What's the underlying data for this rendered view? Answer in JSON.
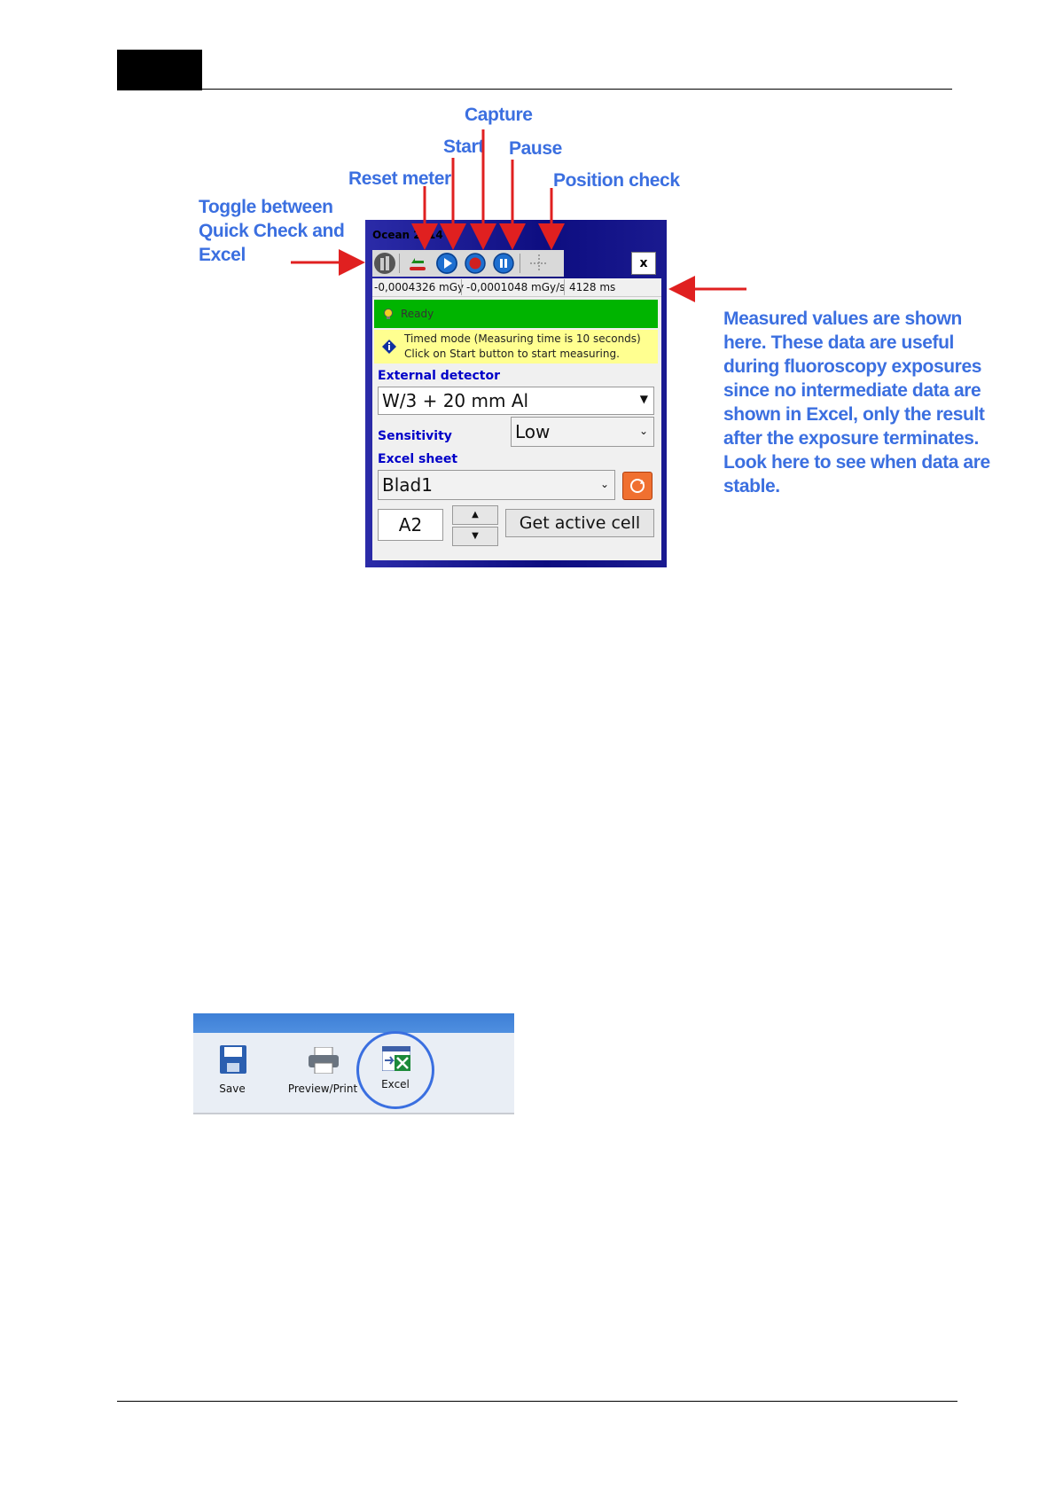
{
  "callouts": {
    "capture": "Capture",
    "start": "Start",
    "pause": "Pause",
    "reset": "Reset meter",
    "position": "Position check",
    "toggle": [
      "Toggle between",
      "Quick Check and",
      "Excel"
    ],
    "measured": [
      "Measured values are shown",
      "here. These data are useful",
      "during fluoroscopy exposures",
      "since no intermediate data are",
      "shown in Excel, only the result",
      "after the exposure terminates.",
      "Look here to see when data are",
      "stable."
    ]
  },
  "window": {
    "title": "Ocean 2014",
    "close": "x",
    "dose": "-0,0004326 mGy",
    "rate": "-0,0001048 mGy/s",
    "time": "4128 ms",
    "status": "Ready",
    "timed_line1": "Timed mode (Measuring time is 10 seconds)",
    "timed_line2": "Click on Start button to start measuring.",
    "ext_label": "External detector",
    "ext_value": "W/3 + 20 mm Al",
    "sens_label": "Sensitivity",
    "sens_value": "Low",
    "sheet_label": "Excel sheet",
    "sheet_value": "Blad1",
    "cell_value": "A2",
    "get_cell": "Get active cell"
  },
  "ribbon": {
    "save": "Save",
    "preview": "Preview/Print",
    "excel": "Excel"
  },
  "colors": {
    "callout": "#3b6fe0",
    "arrow": "#e02020",
    "status_green": "#00b400",
    "info_yellow": "#ffff90"
  }
}
